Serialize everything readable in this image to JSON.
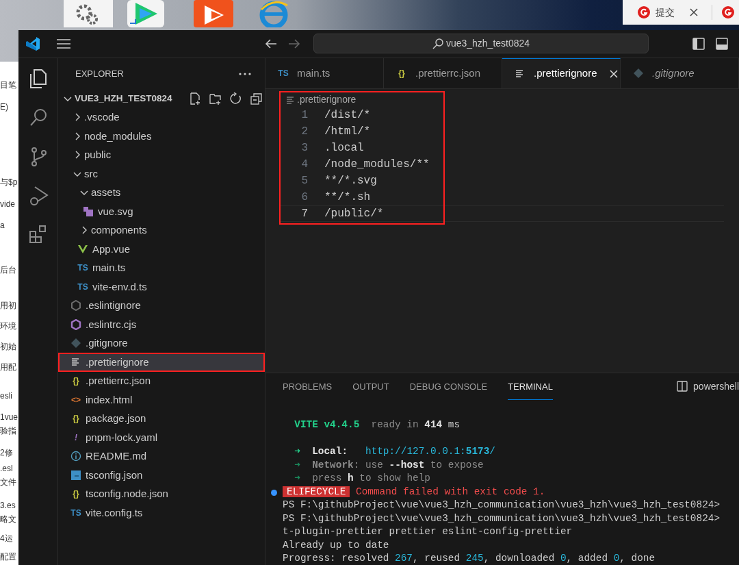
{
  "background_document": {
    "lines": [
      "目笔",
      "E)",
      "与$p",
      "vide",
      "a",
      "后台",
      "用初",
      "环境",
      "初始",
      "用配",
      "esli",
      "1vue",
      "验指",
      "2修",
      ".esl",
      "文件",
      "3.es",
      "略文",
      "4运",
      "配置"
    ]
  },
  "browser_tabs": [
    {
      "label": "提交",
      "closable": true
    },
    {
      "closable": false
    }
  ],
  "window": {
    "search": "vue3_hzh_test0824"
  },
  "explorer": {
    "title": "EXPLORER",
    "root": {
      "label": "VUE3_HZH_TEST0824",
      "expanded": true
    },
    "items": [
      {
        "label": ".vscode",
        "kind": "folder",
        "expanded": false,
        "selected": false
      },
      {
        "label": "node_modules",
        "kind": "folder",
        "expanded": false,
        "selected": false
      },
      {
        "label": "public",
        "kind": "folder",
        "expanded": false,
        "selected": false
      },
      {
        "label": "src",
        "kind": "folder",
        "expanded": true,
        "selected": false,
        "children": [
          {
            "label": "assets",
            "kind": "folder",
            "expanded": true,
            "selected": false,
            "children": [
              {
                "label": "vue.svg",
                "kind": "svg",
                "selected": false
              }
            ]
          },
          {
            "label": "components",
            "kind": "folder",
            "expanded": false,
            "selected": false
          },
          {
            "label": "App.vue",
            "kind": "vue",
            "selected": false
          },
          {
            "label": "main.ts",
            "kind": "ts",
            "icon_text": "TS",
            "selected": false
          },
          {
            "label": "vite-env.d.ts",
            "kind": "ts",
            "icon_text": "TS",
            "selected": false
          }
        ]
      },
      {
        "label": ".eslintignore",
        "kind": "eslintignore",
        "selected": false
      },
      {
        "label": ".eslintrc.cjs",
        "kind": "eslint",
        "selected": false
      },
      {
        "label": ".gitignore",
        "kind": "git",
        "selected": false
      },
      {
        "label": ".prettierignore",
        "kind": "text",
        "selected": true,
        "highlighted": true
      },
      {
        "label": ".prettierrc.json",
        "kind": "json",
        "icon_text": "{}",
        "selected": false
      },
      {
        "label": "index.html",
        "kind": "html",
        "icon_text": "<>",
        "selected": false
      },
      {
        "label": "package.json",
        "kind": "json",
        "icon_text": "{}",
        "selected": false
      },
      {
        "label": "pnpm-lock.yaml",
        "kind": "yaml",
        "icon_text": "!",
        "selected": false
      },
      {
        "label": "README.md",
        "kind": "info",
        "selected": false
      },
      {
        "label": "tsconfig.json",
        "kind": "tsconfig",
        "selected": false
      },
      {
        "label": "tsconfig.node.json",
        "kind": "json",
        "icon_text": "{}",
        "selected": false
      },
      {
        "label": "vite.config.ts",
        "kind": "ts",
        "icon_text": "TS",
        "selected": false
      }
    ]
  },
  "tabs": [
    {
      "label": "main.ts",
      "kind": "ts",
      "icon_text": "TS",
      "selected": false,
      "preview": false
    },
    {
      "label": ".prettierrc.json",
      "kind": "json",
      "icon_text": "{}",
      "selected": false,
      "preview": false
    },
    {
      "label": ".prettierignore",
      "kind": "text",
      "selected": true,
      "preview": false
    },
    {
      "label": ".gitignore",
      "kind": "git",
      "selected": false,
      "preview": true
    }
  ],
  "editor": {
    "breadcrumb": ".prettierignore",
    "highlighted": true,
    "lines": [
      {
        "number": "1",
        "text": "/dist/*",
        "current": false
      },
      {
        "number": "2",
        "text": "/html/*",
        "current": false
      },
      {
        "number": "3",
        "text": ".local",
        "current": false
      },
      {
        "number": "4",
        "text": "/node_modules/**",
        "current": false
      },
      {
        "number": "5",
        "text": "**/*.svg",
        "current": false
      },
      {
        "number": "6",
        "text": "**/*.sh",
        "current": false
      },
      {
        "number": "7",
        "text": "/public/*",
        "current": true
      }
    ]
  },
  "panel": {
    "tabs": [
      {
        "label": "PROBLEMS",
        "selected": false
      },
      {
        "label": "OUTPUT",
        "selected": false
      },
      {
        "label": "DEBUG CONSOLE",
        "selected": false
      },
      {
        "label": "TERMINAL",
        "selected": true
      }
    ],
    "shell": "powershell",
    "terminal": [
      {
        "marker": false,
        "segments": [
          {
            "text": "  VITE v4.4.5",
            "kind": "green-bold"
          },
          {
            "text": "  ready in ",
            "kind": "dim"
          },
          {
            "text": "414",
            "kind": "bold"
          },
          {
            "text": " ms",
            "kind": "plain"
          }
        ]
      },
      {
        "marker": false,
        "segments": [
          {
            "text": "  ➜ ",
            "kind": "green"
          },
          {
            "text": " Local:",
            "kind": "bold"
          },
          {
            "text": "   http://127.0.0.1:",
            "kind": "url"
          },
          {
            "text": "5173",
            "kind": "url-bold"
          },
          {
            "text": "/",
            "kind": "url"
          }
        ]
      },
      {
        "marker": false,
        "segments": [
          {
            "text": "  ➜ ",
            "kind": "green-dim"
          },
          {
            "text": " Network",
            "kind": "dim-bold"
          },
          {
            "text": ": use ",
            "kind": "dim"
          },
          {
            "text": "--host",
            "kind": "bold"
          },
          {
            "text": " to expose",
            "kind": "dim"
          }
        ]
      },
      {
        "marker": false,
        "segments": [
          {
            "text": "  ➜ ",
            "kind": "green-dim"
          },
          {
            "text": " press ",
            "kind": "dim"
          },
          {
            "text": "h",
            "kind": "bold"
          },
          {
            "text": " to show help",
            "kind": "dim"
          }
        ]
      },
      {
        "marker": true,
        "segments": [
          {
            "text": "ELIFECYCLE",
            "kind": "error-badge"
          },
          {
            "text": " Command failed with exit code 1.",
            "kind": "error"
          }
        ]
      },
      {
        "marker": false,
        "segments": [
          {
            "text": "PS F:\\githubProject\\vue\\vue3_hzh_communication\\vue3_hzh\\vue3_hzh_test0824>",
            "kind": "plain"
          }
        ]
      },
      {
        "marker": false,
        "segments": [
          {
            "text": "PS F:\\githubProject\\vue\\vue3_hzh_communication\\vue3_hzh\\vue3_hzh_test0824>",
            "kind": "plain"
          }
        ]
      },
      {
        "marker": false,
        "segments": [
          {
            "text": "t-plugin-prettier prettier eslint-config-prettier",
            "kind": "plain"
          }
        ]
      },
      {
        "marker": false,
        "segments": [
          {
            "text": "Already up to date",
            "kind": "plain"
          }
        ]
      },
      {
        "marker": false,
        "segments": [
          {
            "text": "Progress: resolved ",
            "kind": "plain"
          },
          {
            "text": "267",
            "kind": "url"
          },
          {
            "text": ", reused ",
            "kind": "plain"
          },
          {
            "text": "245",
            "kind": "url"
          },
          {
            "text": ", downloaded ",
            "kind": "plain"
          },
          {
            "text": "0",
            "kind": "url"
          },
          {
            "text": ", added ",
            "kind": "plain"
          },
          {
            "text": "0",
            "kind": "url"
          },
          {
            "text": ", done",
            "kind": "plain"
          }
        ]
      }
    ]
  }
}
